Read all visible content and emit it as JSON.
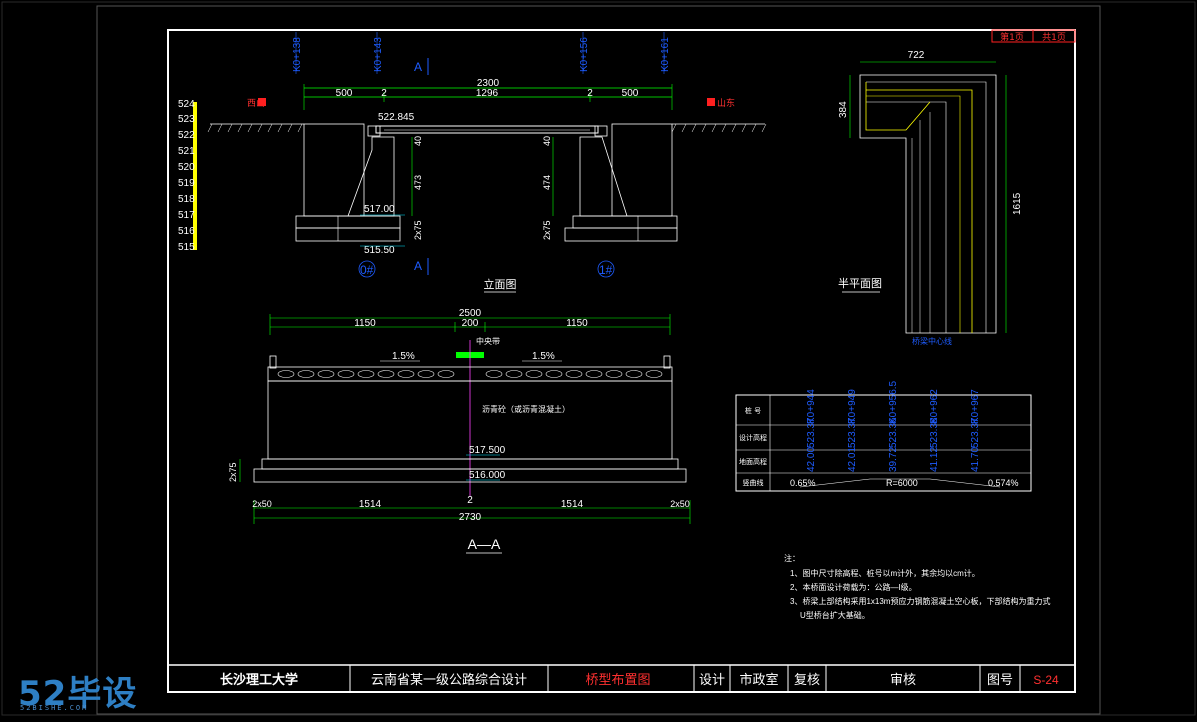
{
  "sheet": {
    "page": "第1页",
    "total": "共1页"
  },
  "stations": [
    "K0+138",
    "K0+143",
    "K0+156",
    "K0+161"
  ],
  "section_mark": "A",
  "direction": {
    "left": "西山",
    "right": "山东"
  },
  "elevation_scale": [
    "524",
    "523",
    "522",
    "521",
    "520",
    "519",
    "518",
    "517",
    "516",
    "515"
  ],
  "elevation_view": {
    "overall": "2300",
    "segments": [
      "500",
      "2",
      "1296",
      "2",
      "500"
    ],
    "deck_elev": "522.845",
    "pier_h_left": "473",
    "pier_h_right": "474",
    "cap_left": "40",
    "cap_right": "40",
    "found_left": "2x75",
    "found_right": "2x75",
    "top_found": "517.00",
    "bottom_found": "515.50",
    "abut_left": "0#",
    "abut_right": "1#",
    "title": "立面图"
  },
  "plan_view": {
    "width": "722",
    "left_dim": "384",
    "length": "1615",
    "centerline": "桥梁中心线",
    "title": "半平面图"
  },
  "section": {
    "overall": "2500",
    "left": "1150",
    "mid": "200",
    "right": "1150",
    "slope_left": "1.5%",
    "slope_right": "1.5%",
    "median_label": "中央带",
    "pavement_note": "沥青砼（或沥青混凝土）",
    "elev_top": "517.500",
    "elev_bottom": "516.000",
    "found": "2x75",
    "bottom_total": "2730",
    "bottom_segments": [
      "2x50",
      "1514",
      "2",
      "1514",
      "2x50"
    ],
    "title": "A—A"
  },
  "profile_table": {
    "row_labels": [
      "桩 号",
      "设计高程",
      "地面高程",
      "竖曲线"
    ],
    "station_values": [
      "K0+944",
      "K0+949",
      "K0+956.5",
      "K0+962",
      "K0+967"
    ],
    "design_values": [
      "523.37",
      "523.37",
      "523.36",
      "523.38",
      "523.37"
    ],
    "ground_values": [
      "42.00",
      "42.01",
      "39.72",
      "41.12",
      "41.70"
    ],
    "curve": {
      "left": "0.65%",
      "mid": "R=6000",
      "right": "0.574%"
    }
  },
  "notes": {
    "heading": "注：",
    "items": [
      "1、图中尺寸除高程、桩号以m计外，其余均以cm计。",
      "2、本桥面设计荷载为：公路—I级。",
      "3、桥梁上部结构采用1x13m预应力钢筋混凝土空心板，下部结构为重力式",
      "U型桥台扩大基础。"
    ]
  },
  "title_block": {
    "school": "长沙理工大学",
    "project": "云南省某一级公路综合设计",
    "drawing": "桥型布置图",
    "design": "设计",
    "designer": "市政室",
    "check": "复核",
    "review": "审核",
    "number_label": "图号",
    "number": "S-24"
  },
  "watermark": {
    "logo": "52毕设",
    "url": "52BISHE.COM"
  },
  "colors": {
    "line": "#ffffff",
    "dim": "#00ff00",
    "label_blue": "#1e5cff",
    "note_yellow": "#ffff00",
    "accent_red": "#ff2020",
    "cyan": "#00e5ff",
    "magenta": "#ff40ff"
  }
}
